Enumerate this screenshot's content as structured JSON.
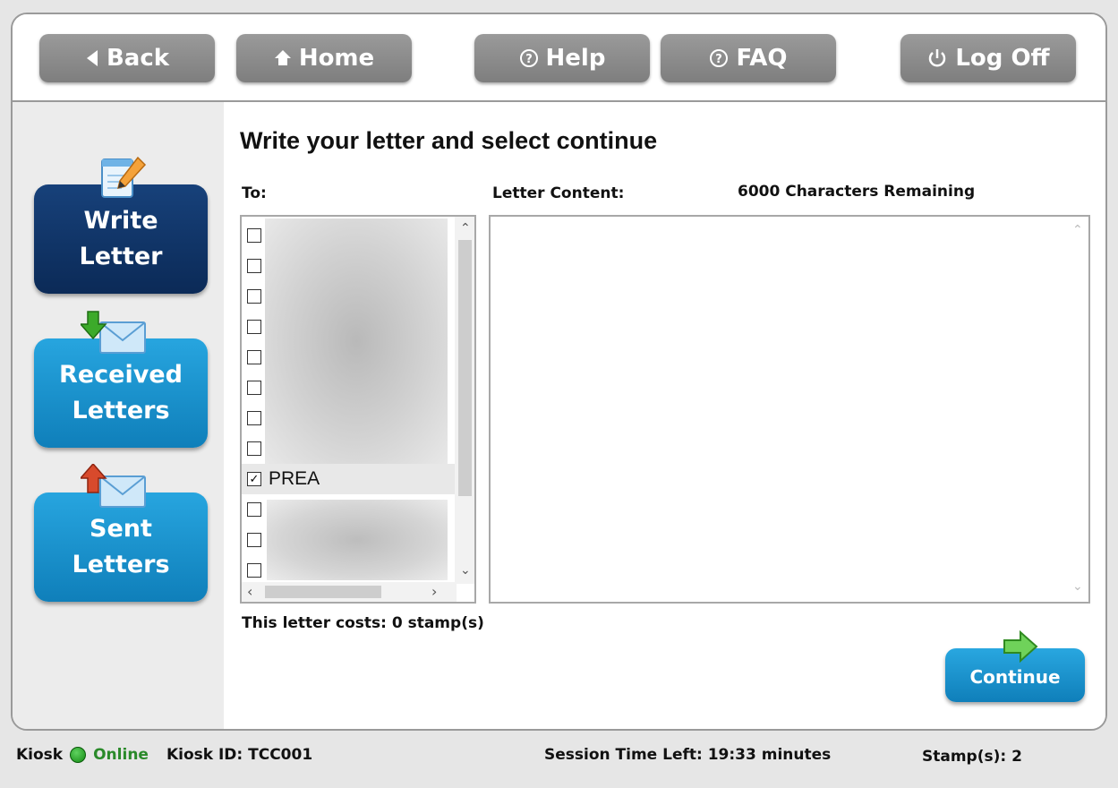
{
  "nav": {
    "back": "Back",
    "home": "Home",
    "help": "Help",
    "faq": "FAQ",
    "logoff": "Log Off"
  },
  "sidebar": {
    "items": [
      {
        "line1": "Write",
        "line2": "Letter",
        "icon": "pencil-paper-icon",
        "active": true
      },
      {
        "line1": "Received",
        "line2": "Letters",
        "icon": "envelope-down-arrow-icon",
        "active": false
      },
      {
        "line1": "Sent",
        "line2": "Letters",
        "icon": "envelope-up-arrow-icon",
        "active": false
      }
    ]
  },
  "main": {
    "title": "Write your letter and select continue",
    "to_label": "To:",
    "content_label": "Letter Content:",
    "remaining": "6000 Characters Remaining",
    "cost": "This letter costs:  0  stamp(s)",
    "continue": "Continue",
    "recipients": [
      {
        "name": "",
        "checked": false
      },
      {
        "name": "",
        "checked": false
      },
      {
        "name": "",
        "checked": false
      },
      {
        "name": "",
        "checked": false
      },
      {
        "name": "",
        "checked": false
      },
      {
        "name": "",
        "checked": false
      },
      {
        "name": "",
        "checked": false
      },
      {
        "name": "",
        "checked": false
      },
      {
        "name": "PREA",
        "checked": true
      },
      {
        "name": "",
        "checked": false
      },
      {
        "name": "",
        "checked": false
      },
      {
        "name": "",
        "checked": false
      }
    ],
    "letter_text": ""
  },
  "status": {
    "kiosk": "Kiosk",
    "online": "Online",
    "kiosk_id": "Kiosk ID:  TCC001",
    "session": "Session Time Left: 19:33 minutes",
    "stamps": "Stamp(s):  2"
  },
  "colors": {
    "active_nav": "#0b2a57",
    "inactive_nav": "#0f7fba",
    "top_button": "#8a8a8a",
    "online": "#2a8a2a"
  }
}
